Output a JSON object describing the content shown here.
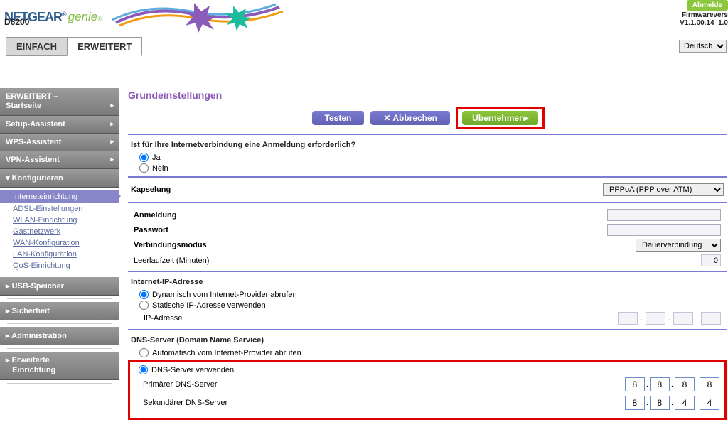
{
  "brand": {
    "name": "NETGEAR",
    "sub": "genie",
    "model": "D6200"
  },
  "logout_btn": "Abmelde",
  "fw_label": "Firmwarevers",
  "fw_version": "V1.1.00.14_1.0",
  "language": "Deutsch",
  "tabs": {
    "basic": "EINFACH",
    "advanced": "ERWEITERT"
  },
  "sidebar": {
    "home1": "ERWEITERT –",
    "home2": "Startseite",
    "setup_wizard": "Setup-Assistent",
    "wps_wizard": "WPS-Assistent",
    "vpn_wizard": "VPN-Assistent",
    "configure": "Konfigurieren",
    "sub": {
      "internet": "Interneteinrichtung",
      "adsl": "ADSL-Einstellungen",
      "wlan": "WLAN-Einrichtung",
      "guest": "Gastnetzwerk",
      "wan": "WAN-Konfiguration",
      "lan": "LAN-Konfiguration",
      "qos": "QoS-Einrichtung"
    },
    "usb": "USB-Speicher",
    "security": "Sicherheit",
    "admin": "Administration",
    "advsetup1": "Erweiterte",
    "advsetup2": "Einrichtung"
  },
  "page_title": "Grundeinstellungen",
  "buttons": {
    "test": "Testen",
    "cancel": "✕ Abbrechen",
    "apply": "Ubernehmen▸"
  },
  "login_q": "Ist für Ihre Internetverbindung eine Anmeldung erforderlich?",
  "yes": "Ja",
  "no": "Nein",
  "encap_label": "Kapselung",
  "encap_value": "PPPoA (PPP over ATM)",
  "login_label": "Anmeldung",
  "password_label": "Passwort",
  "connmode_label": "Verbindungsmodus",
  "connmode_value": "Dauerverbindung",
  "idle_label": "Leerlaufzeit (Minuten)",
  "idle_value": "0",
  "ip_head": "Internet-IP-Adresse",
  "ip_dyn": "Dynamisch vom Internet-Provider abrufen",
  "ip_static": "Statische IP-Adresse verwenden",
  "ip_addr": "IP-Adresse",
  "dns_head": "DNS-Server (Domain Name Service)",
  "dns_auto": "Automatisch vom Internet-Provider abrufen",
  "dns_use": "DNS-Server verwenden",
  "dns_primary": "Primärer DNS-Server",
  "dns_secondary": "Sekundärer DNS-Server",
  "dns_p": [
    "8",
    "8",
    "8",
    "8"
  ],
  "dns_s": [
    "8",
    "8",
    "4",
    "4"
  ]
}
